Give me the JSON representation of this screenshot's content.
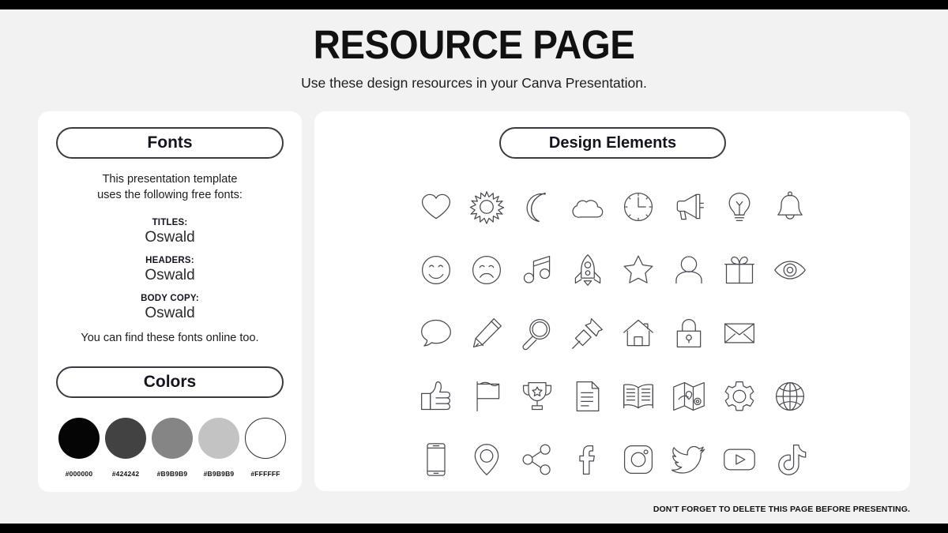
{
  "header": {
    "title": "RESOURCE PAGE",
    "subtitle": "Use these design resources in your Canva Presentation."
  },
  "fonts_panel": {
    "heading": "Fonts",
    "intro": "This presentation template\nuses the following free fonts:",
    "groups": [
      {
        "label": "TITLES:",
        "value": "Oswald"
      },
      {
        "label": "HEADERS:",
        "value": "Oswald"
      },
      {
        "label": "BODY COPY:",
        "value": "Oswald"
      }
    ],
    "outro": "You can find these fonts online too."
  },
  "colors_panel": {
    "heading": "Colors",
    "swatches": [
      {
        "hex_label": "#000000",
        "fill": "#050505"
      },
      {
        "hex_label": "#424242",
        "fill": "#424242"
      },
      {
        "hex_label": "#B9B9B9",
        "fill": "#858585"
      },
      {
        "hex_label": "#B9B9B9",
        "fill": "#c3c3c3"
      },
      {
        "hex_label": "#FFFFFF",
        "fill": "#ffffff"
      }
    ]
  },
  "design_panel": {
    "heading": "Design Elements",
    "icons": [
      "heart-icon",
      "sun-icon",
      "moon-icon",
      "cloud-icon",
      "clock-icon",
      "megaphone-icon",
      "lightbulb-icon",
      "bell-icon",
      "smiley-happy-icon",
      "smiley-sad-icon",
      "music-note-icon",
      "rocket-icon",
      "star-icon",
      "user-icon",
      "gift-icon",
      "eye-icon",
      "speech-bubble-icon",
      "pencil-icon",
      "magnifier-icon",
      "pushpin-icon",
      "house-icon",
      "lock-icon",
      "envelope-icon",
      "",
      "thumbs-up-icon",
      "flag-icon",
      "trophy-icon",
      "document-icon",
      "open-book-icon",
      "map-icon",
      "gear-icon",
      "globe-icon",
      "smartphone-icon",
      "location-pin-icon",
      "share-icon",
      "facebook-icon",
      "instagram-icon",
      "twitter-icon",
      "youtube-icon",
      "tiktok-icon"
    ]
  },
  "footer": {
    "note": "DON'T FORGET TO DELETE THIS PAGE BEFORE PRESENTING."
  },
  "theme": {
    "background": "#f2f2f2",
    "card_background": "#ffffff",
    "bar_color": "#000000",
    "icon_stroke": "#4a4a52",
    "text_color": "#14141e"
  }
}
